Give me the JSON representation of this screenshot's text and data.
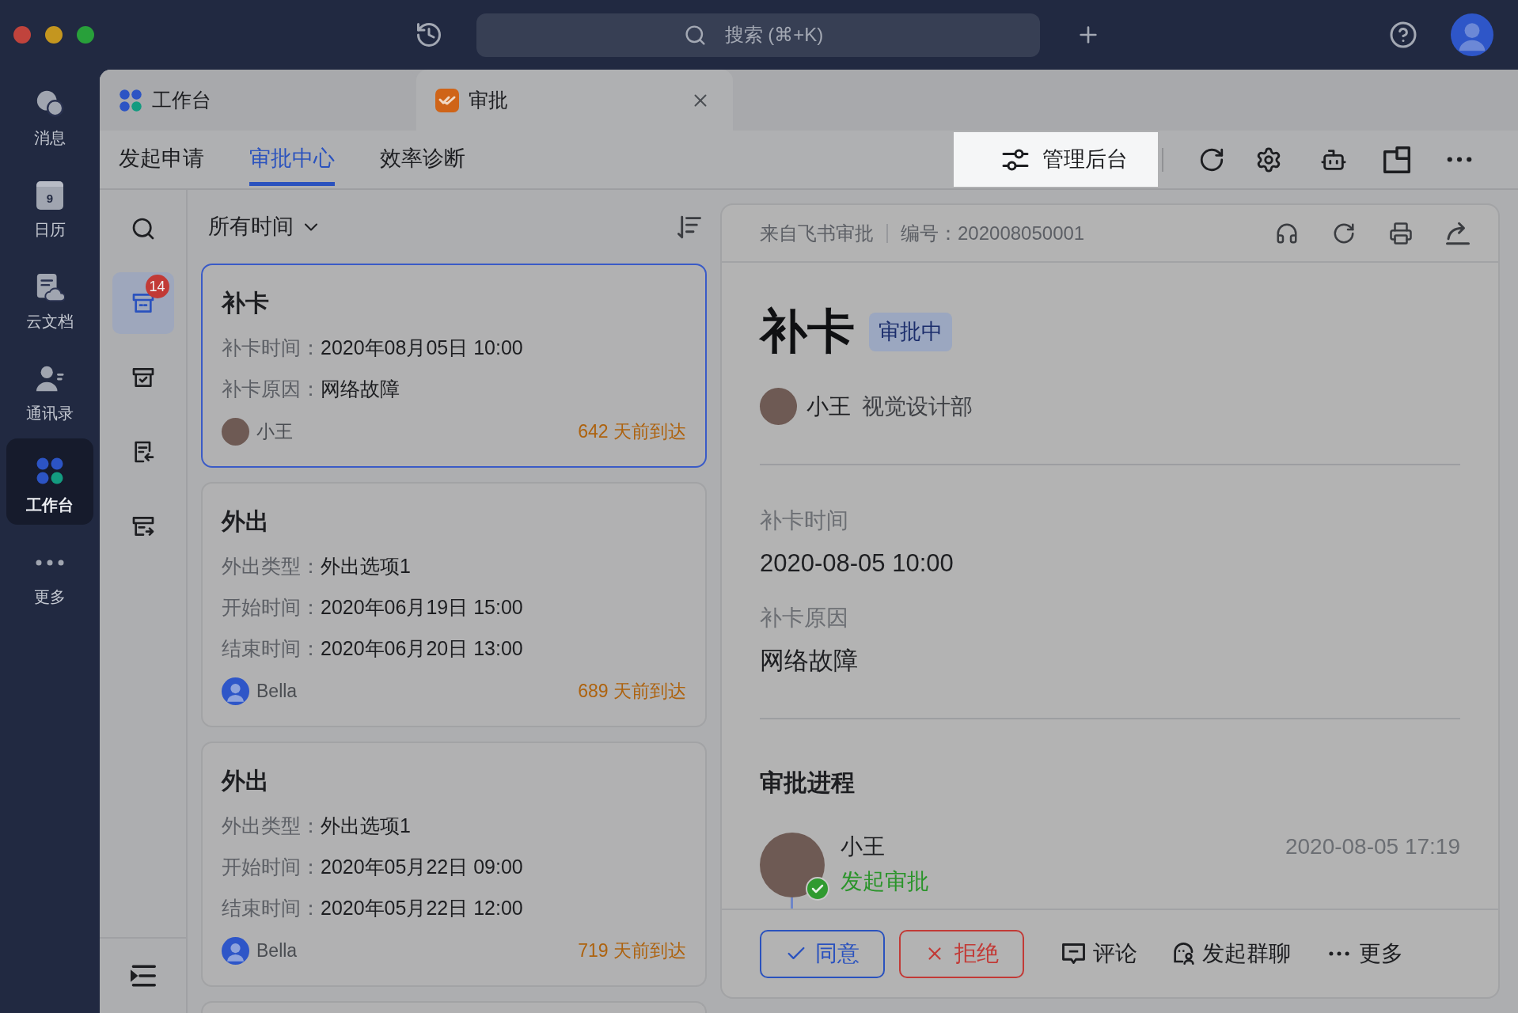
{
  "title_bar": {
    "search": {
      "placeholder": "搜索 (⌘+K)"
    }
  },
  "nav": {
    "items": [
      {
        "label": "消息",
        "selected": false
      },
      {
        "label": "日历",
        "selected": false,
        "date": "9"
      },
      {
        "label": "云文档",
        "selected": false
      },
      {
        "label": "通讯录",
        "selected": false
      },
      {
        "label": "工作台",
        "selected": true
      },
      {
        "label": "更多",
        "selected": false
      }
    ]
  },
  "tabs": [
    {
      "label": "工作台",
      "selected": false
    },
    {
      "label": "审批",
      "selected": true
    }
  ],
  "toolbar": {
    "tabs": [
      {
        "label": "发起申请",
        "selected": false
      },
      {
        "label": "审批中心",
        "selected": true
      },
      {
        "label": "效率诊断",
        "selected": false
      }
    ],
    "admin_button": {
      "label": "管理后台",
      "highlighted": true
    }
  },
  "side_tools": [
    {
      "selected": false
    },
    {
      "selected": true,
      "badge": "14"
    },
    {
      "selected": false
    },
    {
      "selected": false
    },
    {
      "selected": false
    }
  ],
  "list": {
    "filter": "所有时间",
    "cards": [
      {
        "title": "补卡",
        "selected": true,
        "fields": [
          {
            "label": "补卡时间：",
            "value": "2020年08月05日 10:00"
          },
          {
            "label": "补卡原因：",
            "value": "网络故障"
          }
        ],
        "author": {
          "name": "小王",
          "avatar": {
            "kind": "photo"
          }
        },
        "arrival": "642 天前到达"
      },
      {
        "title": "外出",
        "selected": false,
        "fields": [
          {
            "label": "外出类型：",
            "value": "外出选项1"
          },
          {
            "label": "开始时间：",
            "value": "2020年06月19日 15:00"
          },
          {
            "label": "结束时间：",
            "value": "2020年06月20日 13:00"
          }
        ],
        "author": {
          "name": "Bella",
          "avatar": {
            "kind": "default"
          }
        },
        "arrival": "689 天前到达"
      },
      {
        "title": "外出",
        "selected": false,
        "fields": [
          {
            "label": "外出类型：",
            "value": "外出选项1"
          },
          {
            "label": "开始时间：",
            "value": "2020年05月22日 09:00"
          },
          {
            "label": "结束时间：",
            "value": "2020年05月22日 12:00"
          }
        ],
        "author": {
          "name": "Bella",
          "avatar": {
            "kind": "default"
          }
        },
        "arrival": "719 天前到达"
      },
      {
        "selected": false
      }
    ]
  },
  "detail": {
    "source": "来自飞书审批",
    "number": "编号：202008050001",
    "title": "补卡",
    "status": "审批中",
    "applicant": {
      "name": "小王",
      "department": "视觉设计部",
      "avatar": {
        "kind": "photo"
      }
    },
    "fields": [
      {
        "label": "补卡时间",
        "value": "2020-08-05 10:00"
      },
      {
        "label": "补卡原因",
        "value": "网络故障"
      }
    ],
    "progress": {
      "title": "审批进程",
      "steps": [
        {
          "name": "小王",
          "action": "发起审批",
          "time": "2020-08-05 17:19",
          "done": true,
          "avatar": {
            "kind": "photo"
          }
        }
      ]
    },
    "actions": [
      {
        "label": "同意",
        "kind": "approve"
      },
      {
        "label": "拒绝",
        "kind": "reject"
      },
      {
        "label": "评论",
        "kind": "comment"
      },
      {
        "label": "发起群聊",
        "kind": "group_chat"
      },
      {
        "label": "更多",
        "kind": "more"
      }
    ]
  }
}
